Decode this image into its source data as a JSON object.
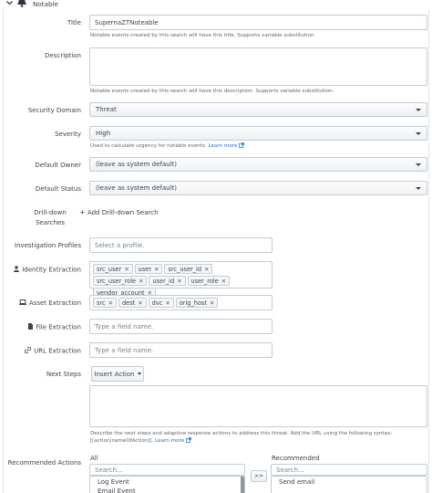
{
  "section": {
    "title": "Notable"
  },
  "fields": {
    "title": {
      "label": "Title",
      "value": "SupernaZTNoteable",
      "help": "Notable events created by this search will have this title. Supports variable substitution."
    },
    "description": {
      "label": "Description",
      "value": "",
      "help": "Notable events created by this search will have this description. Supports variable substitution."
    },
    "security_domain": {
      "label": "Security Domain",
      "value": "Threat"
    },
    "severity": {
      "label": "Severity",
      "value": "High",
      "help": "Used to calculate urgency for notable events.",
      "help_link": "Learn more"
    },
    "default_owner": {
      "label": "Default Owner",
      "value": "(leave as system default)"
    },
    "default_status": {
      "label": "Default Status",
      "value": "(leave as system default)"
    },
    "drilldown": {
      "label_line1": "Drill-down",
      "label_line2": "Searches",
      "add_label": "Add Drill-down Search"
    },
    "investigation_profiles": {
      "label": "Investigation Profiles",
      "placeholder": "Select a profile."
    },
    "identity_extraction": {
      "label": "Identity Extraction",
      "tags": [
        "src_user",
        "user",
        "src_user_id",
        "src_user_role",
        "user_id",
        "user_role",
        "vendor_account"
      ]
    },
    "asset_extraction": {
      "label": "Asset Extraction",
      "tags": [
        "src",
        "dest",
        "dvc",
        "orig_host"
      ]
    },
    "file_extraction": {
      "label": "File Extraction",
      "placeholder": "Type a field name."
    },
    "url_extraction": {
      "label": "URL Extraction",
      "placeholder": "Type a field name."
    },
    "next_steps": {
      "label": "Next Steps",
      "button": "Insert Action",
      "value": "",
      "help_line1": "Describe the next steps and adaptive response actions to address this threat. Add the URL using the following syntax:",
      "help_line2": "[[action|nameOfAction]].",
      "help_link": "Learn more"
    },
    "recommended_actions": {
      "label": "Recommended Actions",
      "all_header": "All",
      "recommended_header": "Recommended",
      "all_search_placeholder": "Search...",
      "recommended_search_placeholder": "Search...",
      "move_button": ">>",
      "all_items": [
        "Log Event",
        "Email Event"
      ],
      "recommended_items": [
        "Send email"
      ]
    }
  },
  "colors": {
    "link": "#1a73d9",
    "border": "#c3cbd4",
    "text": "#3c444d"
  },
  "icons": {
    "collapse": "chevron-down-icon",
    "notable": "bell-icon",
    "identity": "user-icon",
    "asset": "laptop-icon",
    "file": "file-icon",
    "url": "link-icon",
    "external": "external-link-icon",
    "add": "plus-icon"
  }
}
